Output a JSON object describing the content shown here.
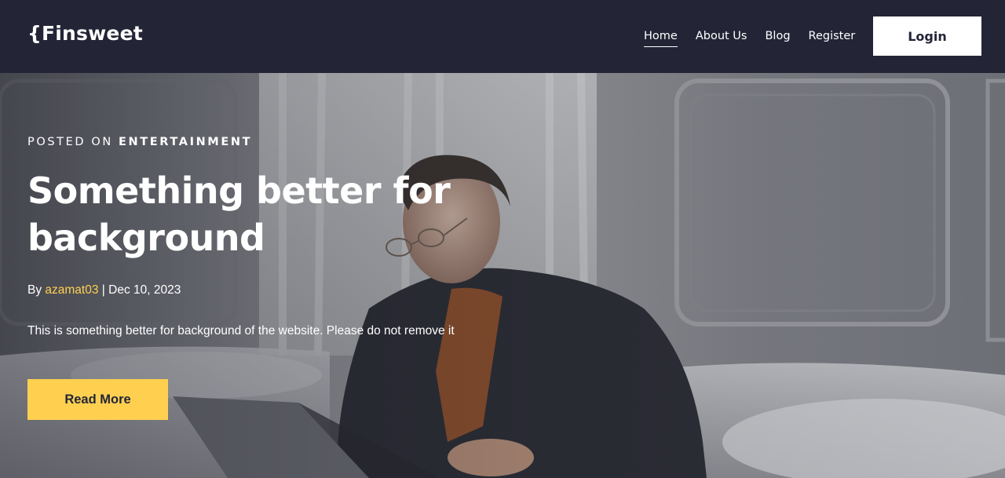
{
  "brand": {
    "logo_text": "{Finsweet"
  },
  "nav": {
    "items": [
      {
        "label": "Home",
        "active": true
      },
      {
        "label": "About Us",
        "active": false
      },
      {
        "label": "Blog",
        "active": false
      },
      {
        "label": "Register",
        "active": false
      }
    ],
    "login_label": "Login"
  },
  "hero": {
    "posted_prefix": "POSTED ON ",
    "category": "ENTERTAINMENT",
    "title": "Something better for background",
    "by_prefix": "By ",
    "author": "azamat03",
    "separator": " | ",
    "date": "Dec 10, 2023",
    "description": "This is something better for background of the website. Please do not remove it",
    "cta_label": "Read More",
    "image": "man-with-laptop-photo"
  },
  "colors": {
    "nav_bg": "#232536",
    "accent": "#FFD050",
    "white": "#FFFFFF"
  }
}
